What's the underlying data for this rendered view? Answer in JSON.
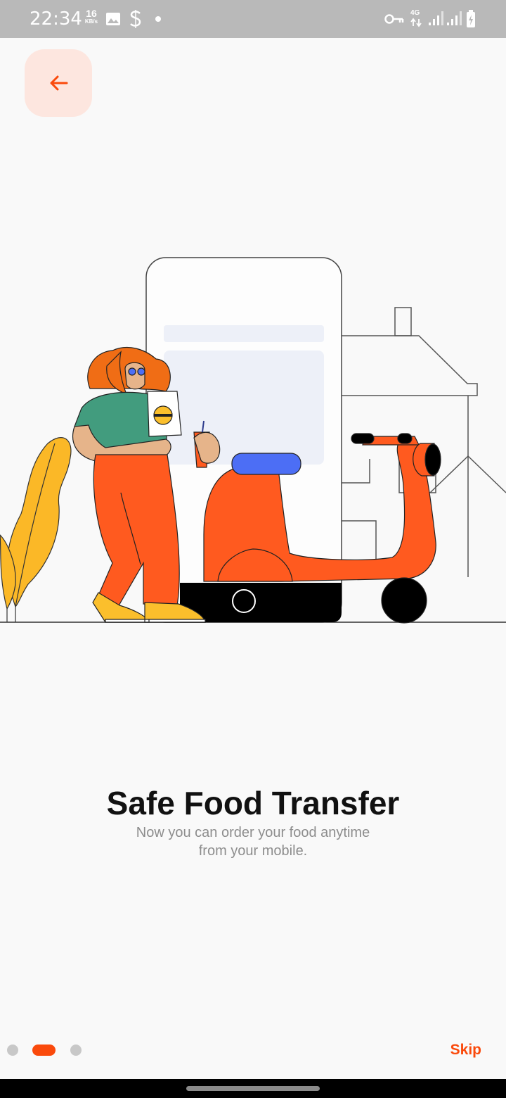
{
  "status_bar": {
    "time": "22:34",
    "net_speed_value": "16",
    "net_speed_unit": "KB/s",
    "network_type": "4G",
    "icons": [
      "image-icon",
      "s-app-icon",
      "notification-dot-icon",
      "vpn-key-icon",
      "signal-icon",
      "signal-icon",
      "battery-charging-icon"
    ]
  },
  "header": {
    "back_icon": "arrow-left-icon"
  },
  "onboarding": {
    "title": "Safe Food Transfer",
    "subtitle": "Now you can order your food anytime from your mobile.",
    "page_indicator": {
      "count": 3,
      "active_index": 1
    },
    "skip_label": "Skip"
  },
  "colors": {
    "accent": "#fa4a0c",
    "back_button_bg": "#fde6df",
    "title": "#111111",
    "subtitle": "#8d8d8d",
    "background": "#f9f9f9"
  }
}
